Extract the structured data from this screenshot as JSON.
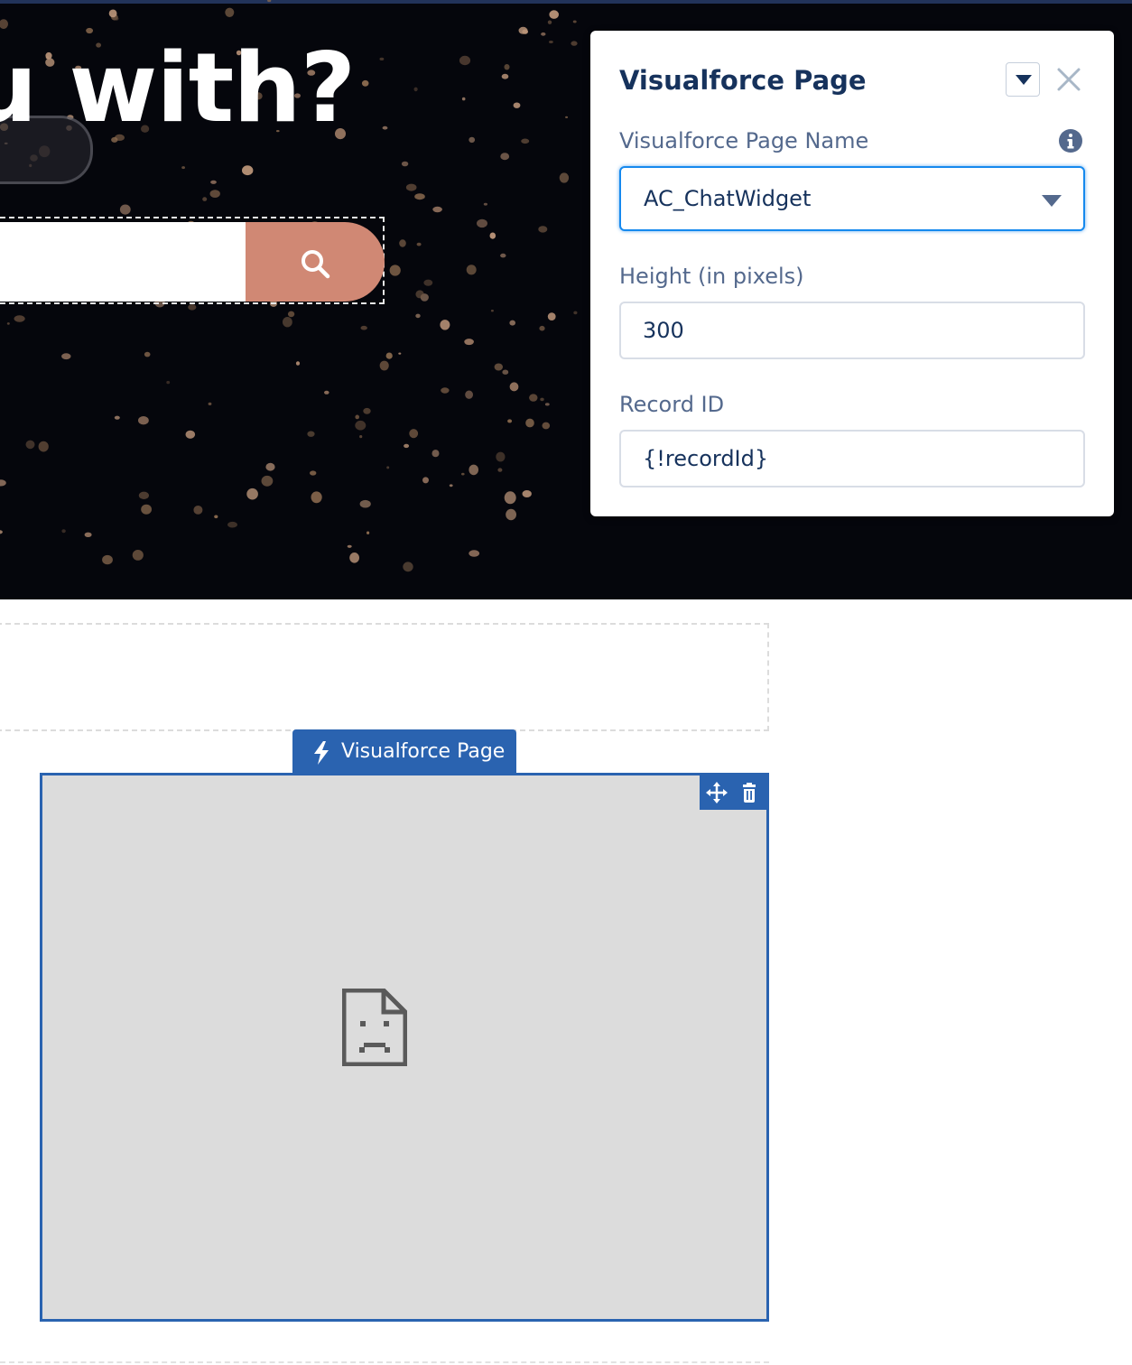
{
  "hero": {
    "heading": "u with?",
    "search": {
      "value": "",
      "button_icon": "search-icon"
    }
  },
  "panel": {
    "title": "Visualforce Page",
    "menu_icon": "chevron-down-icon",
    "close_icon": "close-icon",
    "fields": {
      "page_name": {
        "label": "Visualforce Page Name",
        "value": "AC_ChatWidget",
        "info_icon": "info-icon"
      },
      "height": {
        "label": "Height (in pixels)",
        "value": "300"
      },
      "record_id": {
        "label": "Record ID",
        "value": "{!recordId}"
      }
    }
  },
  "component": {
    "tag_label": "Visualforce Page",
    "tag_icon": "lightning-bolt-icon",
    "actions": [
      "move-icon",
      "trash-icon"
    ],
    "placeholder_icon": "broken-page-icon"
  },
  "colors": {
    "hero_background": "#05060c",
    "search_button": "#d08874",
    "panel_title": "#16325c",
    "label": "#54698d",
    "focus_border": "#1589ee",
    "component_blue": "#2a63b0",
    "frame_fill": "#dcdcdc"
  }
}
